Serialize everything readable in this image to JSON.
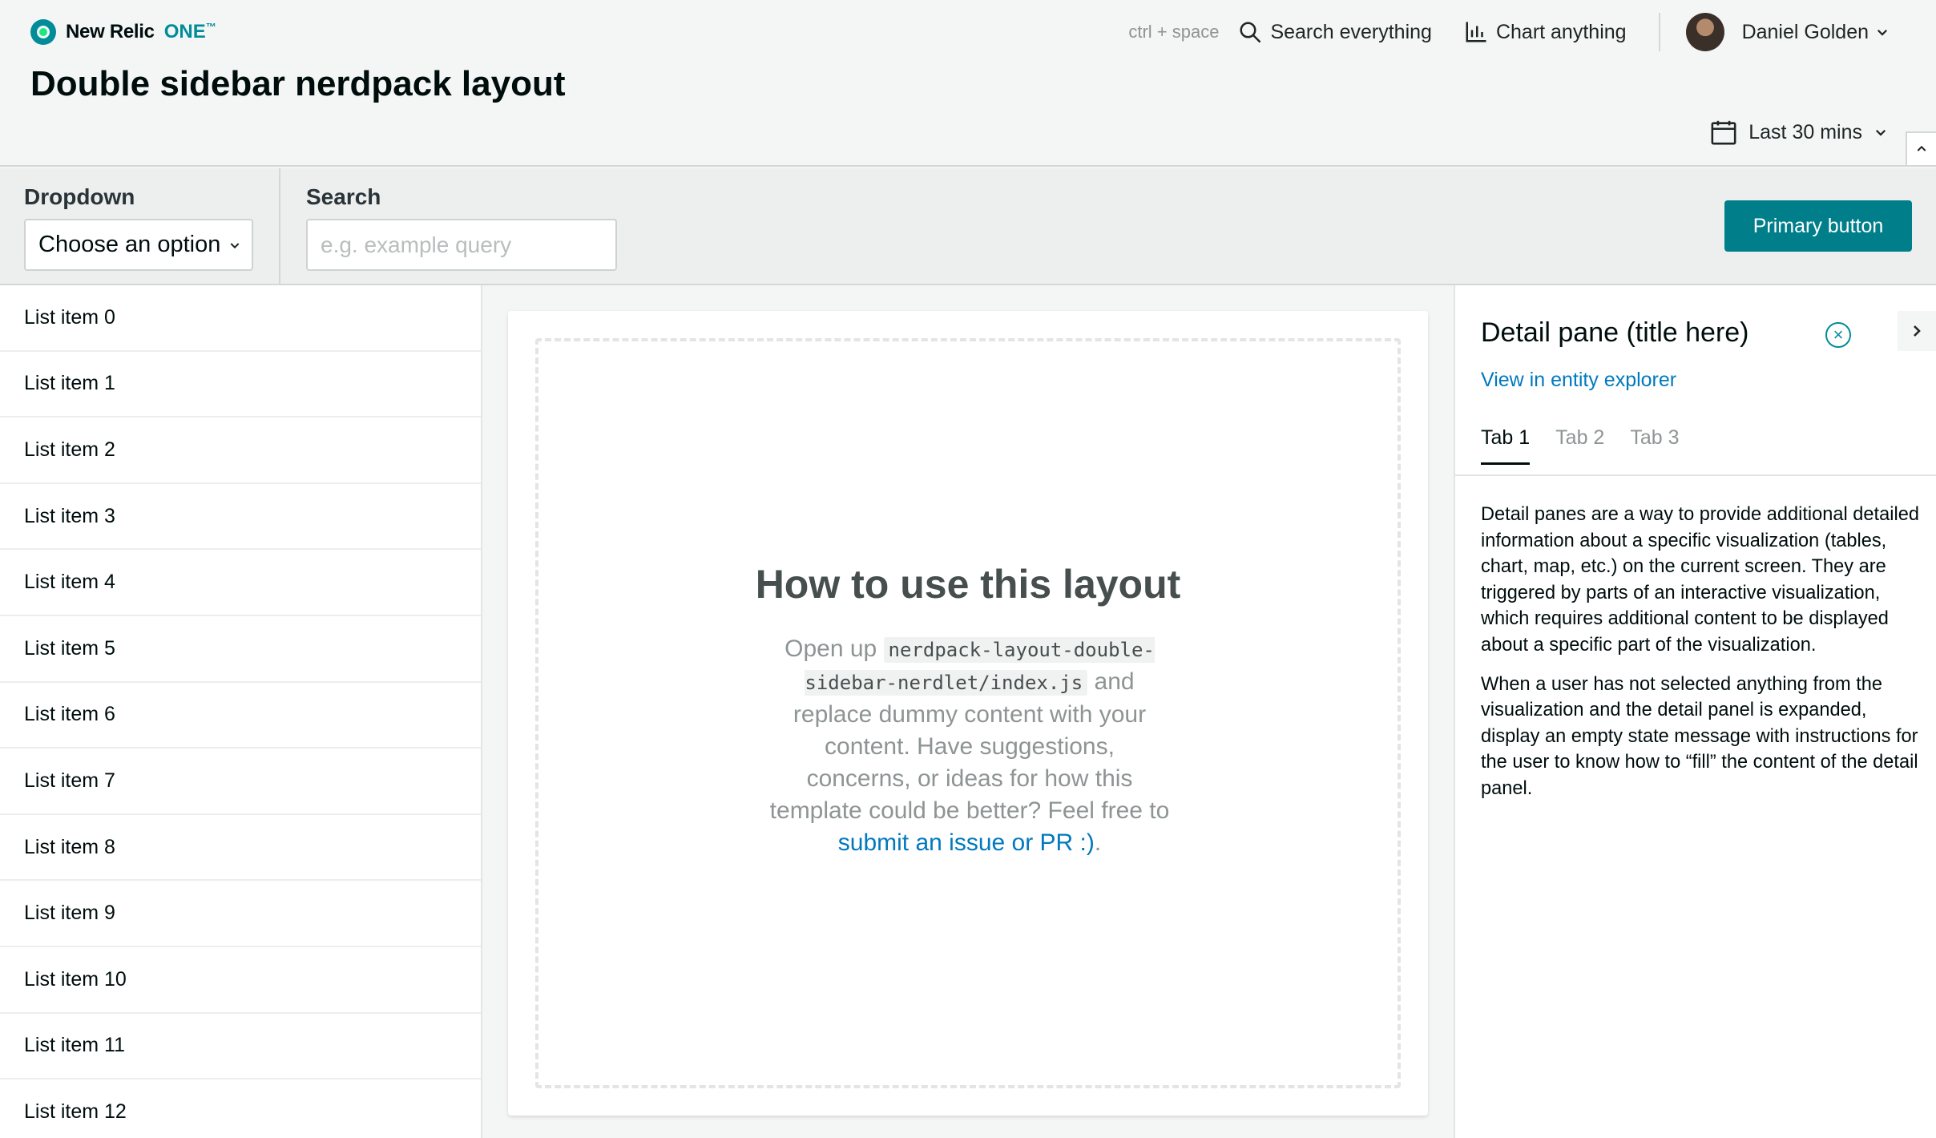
{
  "app": {
    "brand": "New Relic",
    "brand_one": "ONE",
    "brand_tm": "™",
    "page_title": "Double sidebar nerdpack layout"
  },
  "header": {
    "shortcut": "ctrl + space",
    "search_label": "Search everything",
    "chart_label": "Chart anything",
    "user_name": "Daniel Golden",
    "time_range": "Last 30 mins"
  },
  "toolbar": {
    "dropdown_label": "Dropdown",
    "dropdown_value": "Choose an option",
    "search_label": "Search",
    "search_placeholder": "e.g. example query",
    "primary_button": "Primary button"
  },
  "sidebar": {
    "items": [
      {
        "label": "List item 0"
      },
      {
        "label": "List item 1"
      },
      {
        "label": "List item 2"
      },
      {
        "label": "List item 3"
      },
      {
        "label": "List item 4"
      },
      {
        "label": "List item 5"
      },
      {
        "label": "List item 6"
      },
      {
        "label": "List item 7"
      },
      {
        "label": "List item 8"
      },
      {
        "label": "List item 9"
      },
      {
        "label": "List item 10"
      },
      {
        "label": "List item 11"
      },
      {
        "label": "List item 12"
      }
    ]
  },
  "main": {
    "empty_title": "How to use this layout",
    "body_pre": "Open up ",
    "body_code": "nerdpack-layout-double-sidebar-nerdlet/index.js",
    "body_mid": " and replace dummy content with your content. Have suggestions, concerns, or ideas for how this template could be better? Feel free to ",
    "body_link": "submit an issue or PR :)",
    "body_post": "."
  },
  "detail": {
    "title": "Detail pane (title here)",
    "link": "View in entity explorer",
    "tabs": [
      {
        "label": "Tab 1"
      },
      {
        "label": "Tab 2"
      },
      {
        "label": "Tab 3"
      }
    ],
    "paragraph1": "Detail panes are a way to provide additional detailed information about a specific visualization (tables, chart, map, etc.) on the current screen. They are triggered by parts of an interactive visualization, which requires additional content to be displayed about a specific part of the visualization.",
    "paragraph2": "When a user has not selected anything from the visualization and the detail panel is expanded, display an empty state message with instructions for the user to know how to “fill” the content of the detail panel."
  },
  "colors": {
    "accent": "#008c99",
    "primary_button": "#007e8a",
    "link": "#0079bf"
  },
  "icons": {
    "search": "search-icon",
    "chart": "chart-icon",
    "calendar": "calendar-icon",
    "chevron_down": "chevron-down-icon",
    "close": "close-circle-icon",
    "collapse_right": "chevron-right-icon",
    "collapse_up": "chevron-up-icon"
  }
}
